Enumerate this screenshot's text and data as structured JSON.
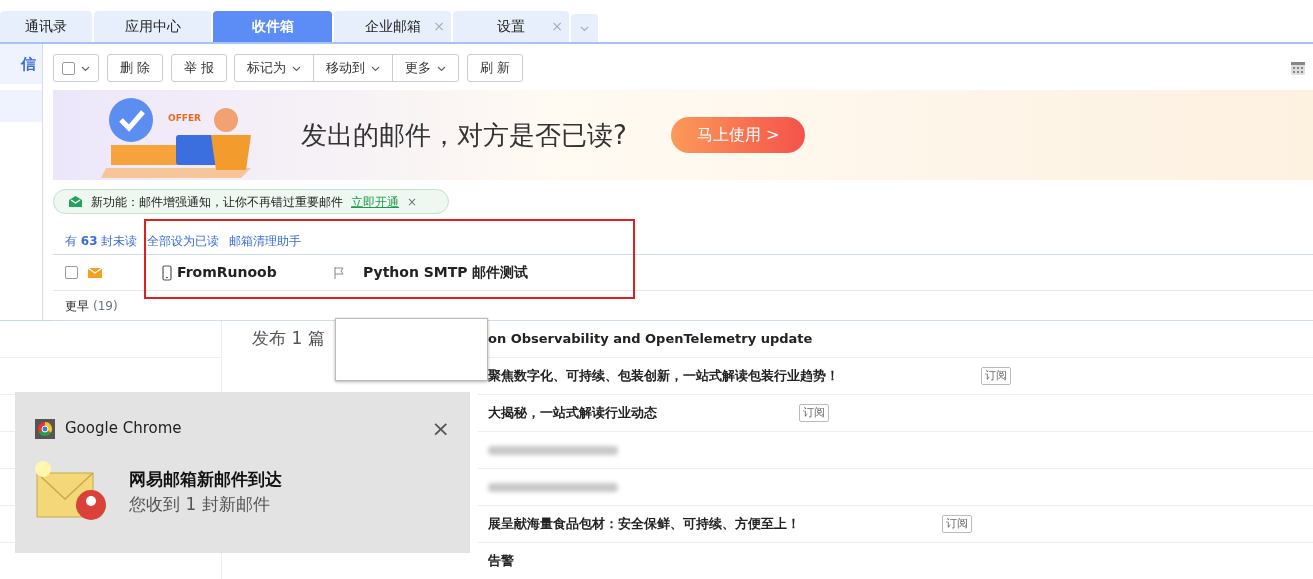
{
  "tabs": [
    {
      "label": "通讯录",
      "selected": false
    },
    {
      "label": "应用中心",
      "selected": false
    },
    {
      "label": "收件箱",
      "selected": true
    },
    {
      "label": "企业邮箱",
      "selected": false,
      "close_glyph": "×"
    },
    {
      "label": "设置",
      "selected": false,
      "close_glyph": "×"
    }
  ],
  "sidebar": {
    "compose_label": "信"
  },
  "toolbar": {
    "select_all_checked": false,
    "buttons": [
      {
        "label": "删 除",
        "kind": "plain"
      },
      {
        "label": "举 报",
        "kind": "plain"
      },
      {
        "label": "标记为",
        "kind": "menu"
      },
      {
        "label": "移动到",
        "kind": "menu"
      },
      {
        "label": "更多",
        "kind": "menu"
      },
      {
        "label": "刷 新",
        "kind": "plain"
      }
    ]
  },
  "banner": {
    "badge": "OFFER",
    "headline": "发出的邮件，对方是否已读?",
    "button": "马上使用 >"
  },
  "notice": {
    "text": "新功能：邮件增强通知，让你不再错过重要邮件",
    "link": "立即开通",
    "close_glyph": "×"
  },
  "summary": {
    "unread": "有 **63** 封未读",
    "links": [
      "全部设为已读",
      "邮箱清理助手"
    ]
  },
  "messages": [
    {
      "sender": "FromRunoob",
      "subject": "Python SMTP 邮件测试",
      "checked": false,
      "unread": true,
      "flagged": false
    }
  ],
  "group": {
    "label": "更早",
    "count": "(19)"
  },
  "background_page": {
    "heading": "发布 1 篇",
    "rows": [
      {
        "subject": "on Observability and OpenTelemetry update"
      },
      {
        "subject": "聚焦数字化、可持续、包装创新，一站式解读包装行业趋势！",
        "tag": "订阅"
      },
      {
        "subject": "大揭秘，一站式解读行业动态",
        "tag": "订阅"
      },
      {
        "kind": "redacted"
      },
      {
        "kind": "redacted"
      },
      {
        "subject": "展呈献海量食品包材：安全保鲜、可持续、方便至上！",
        "tag": "订阅"
      },
      {
        "subject": "告警"
      }
    ]
  },
  "notification": {
    "app": "Google Chrome",
    "title": "网易邮箱新邮件到达",
    "body": "您收到 1 封新邮件",
    "close_glyph": "×"
  }
}
